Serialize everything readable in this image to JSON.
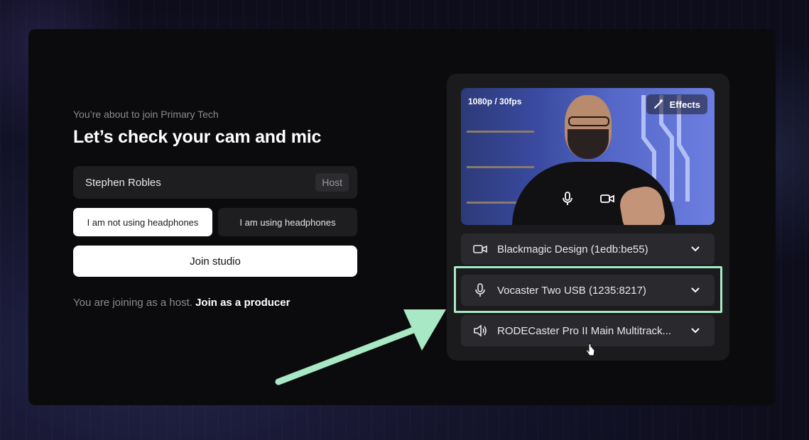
{
  "join": {
    "subtitle": "You’re about to join Primary Tech",
    "title": "Let’s check your cam and mic",
    "name_value": "Stephen Robles",
    "role_badge": "Host",
    "headphones_off_label": "I am not using headphones",
    "headphones_on_label": "I am using headphones",
    "join_button": "Join studio",
    "host_note": "You are joining as a host.",
    "producer_link": "Join as a producer"
  },
  "preview": {
    "resolution": "1080p / 30fps",
    "effects_label": "Effects"
  },
  "devices": {
    "camera": "Blackmagic Design (1edb:be55)",
    "microphone": "Vocaster Two USB (1235:8217)",
    "speaker": "RODECaster Pro II Main Multitrack..."
  },
  "colors": {
    "highlight": "#a8e8c4",
    "card_bg": "#0b0b0d",
    "panel_bg": "#1b1b1e"
  }
}
